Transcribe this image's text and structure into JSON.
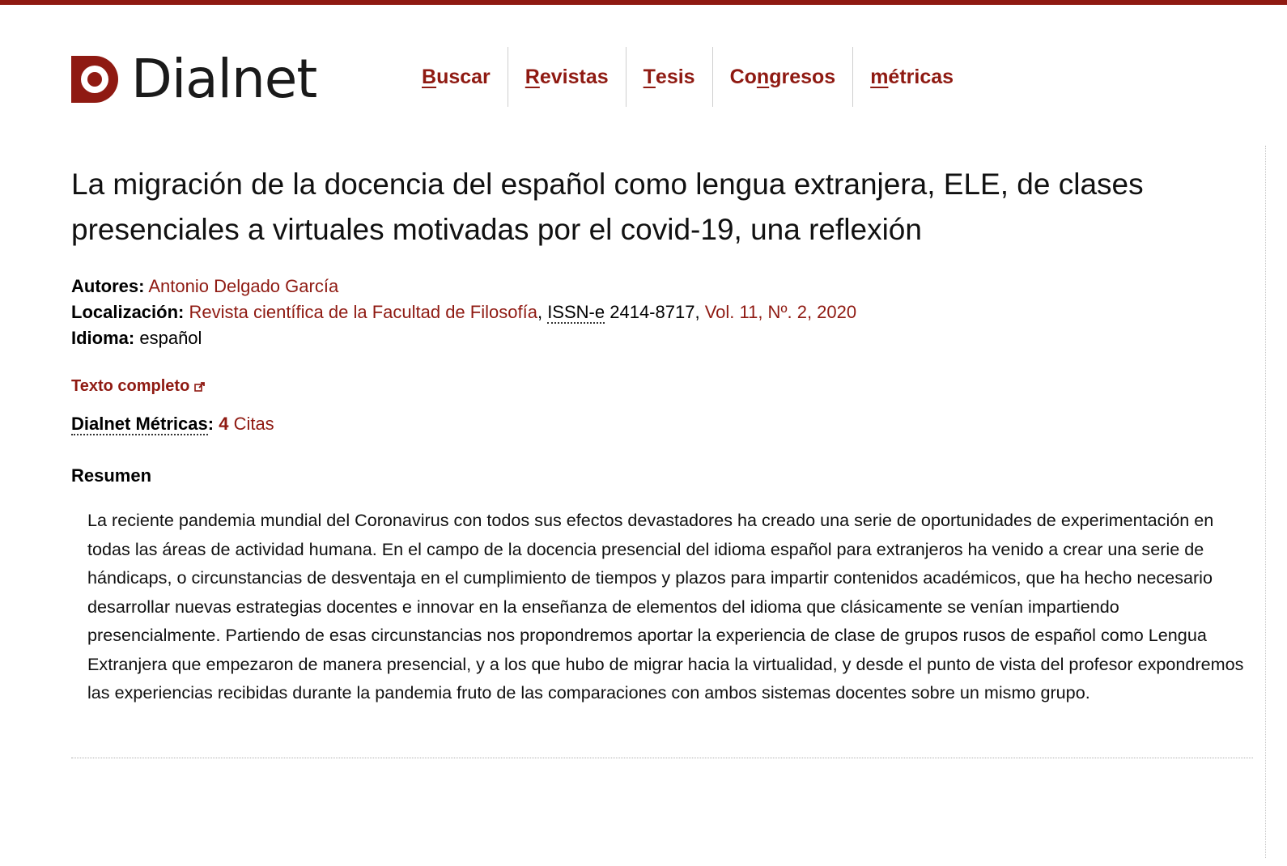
{
  "brand": {
    "name": "Dialnet",
    "accent": "#8f1a12"
  },
  "nav": {
    "items": [
      {
        "label": "Buscar",
        "key": "B",
        "rest": "uscar",
        "pre": ""
      },
      {
        "label": "Revistas",
        "key": "R",
        "rest": "evistas",
        "pre": ""
      },
      {
        "label": "Tesis",
        "key": "T",
        "rest": "esis",
        "pre": ""
      },
      {
        "label": "Congresos",
        "key": "n",
        "rest": "gresos",
        "pre": "Co"
      },
      {
        "label": "métricas",
        "key": "m",
        "rest": "étricas",
        "pre": ""
      }
    ]
  },
  "article": {
    "title": "La migración de la docencia del español como lengua extranjera, ELE, de clases presenciales a virtuales motivadas por el covid-19, una reflexión",
    "autores_label": "Autores:",
    "autor": "Antonio Delgado García",
    "localizacion_label": "Localización:",
    "revista": "Revista científica de la Facultad de Filosofía",
    "sep1": ",",
    "issn_label": "ISSN-e",
    "issn_value": "2414-8717,",
    "volumen": "Vol. 11, Nº. 2, 2020",
    "idioma_label": "Idioma:",
    "idioma": "español",
    "texto_completo": "Texto completo",
    "metricas_label": "Dialnet Métricas",
    "metricas_colon": ":",
    "citas_num": "4",
    "citas_label": "Citas",
    "resumen_heading": "Resumen",
    "resumen": "La reciente pandemia mundial del Coronavirus con todos sus efectos devastadores ha creado una serie de oportunidades de experimentación en todas las áreas de actividad humana. En el campo de la docencia presencial del idioma español para extranjeros ha venido a crear una serie de hándicaps, o circunstancias de desventaja en el cumplimiento de tiempos y plazos para impartir contenidos académicos, que ha hecho necesario desarrollar nuevas estrategias docentes e innovar en la enseñanza de elementos del idioma que clásicamente se venían impartiendo presencialmente. Partiendo de esas circunstancias nos propondremos aportar la experiencia de clase de grupos rusos de español como Lengua Extranjera que empezaron de manera presencial, y a los que hubo de migrar hacia la virtualidad, y desde el punto de vista del profesor expondremos las experiencias recibidas durante la pandemia fruto de las comparaciones con ambos sistemas docentes sobre un mismo grupo."
  }
}
